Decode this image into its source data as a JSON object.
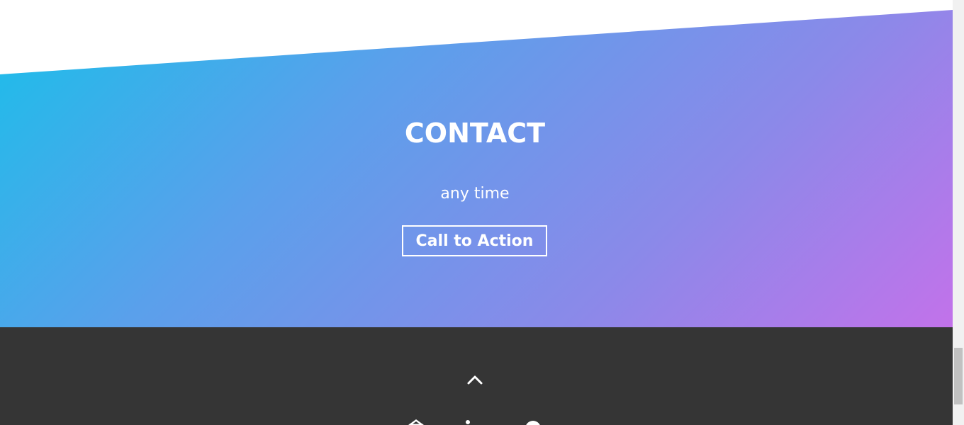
{
  "contact": {
    "title": "CONTACT",
    "subtitle": "any time",
    "cta_label": "Call to Action"
  },
  "footer": {
    "back_to_top_icon": "chevron-up-icon",
    "social_icons": [
      "github-icon",
      "linkedin-icon",
      "location-icon"
    ]
  },
  "colors": {
    "gradient_start": "#19bfea",
    "gradient_end": "#c272ea",
    "footer_bg": "#353535",
    "text": "#ffffff"
  }
}
